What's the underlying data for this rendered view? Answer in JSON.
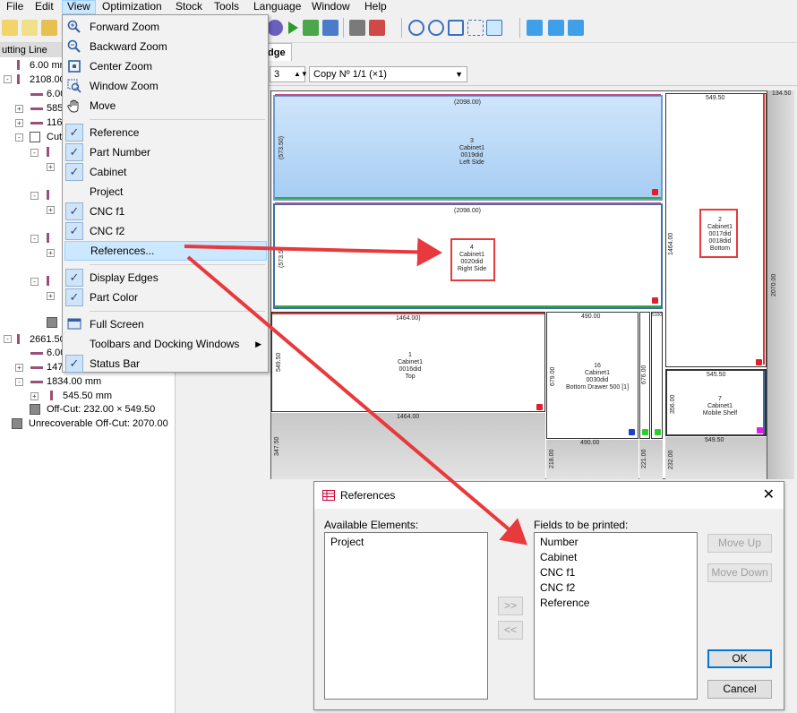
{
  "menubar": {
    "items": [
      "File",
      "Edit",
      "View",
      "Optimization",
      "Stock",
      "Tools",
      "Language",
      "Window",
      "Help"
    ]
  },
  "tree": {
    "header": "utting Line",
    "rows": [
      "6.00 mm",
      "2108.00",
      "6.00",
      "585",
      "116",
      "Cut",
      "2661.50",
      "6.00",
      "147",
      "1834.00 mm",
      "545.50 mm",
      "Off-Cut: 232.00 × 549.50",
      "Unrecoverable Off-Cut: 2070.00"
    ]
  },
  "view_menu": {
    "items": [
      {
        "label": "Forward Zoom",
        "icon": "zoom-in-icon"
      },
      {
        "label": "Backward Zoom",
        "icon": "zoom-out-icon"
      },
      {
        "label": "Center Zoom",
        "icon": "center-zoom-icon"
      },
      {
        "label": "Window Zoom",
        "icon": "window-zoom-icon"
      },
      {
        "label": "Move",
        "icon": "hand-icon"
      },
      {
        "label": "Reference",
        "checked": true
      },
      {
        "label": "Part Number",
        "checked": true
      },
      {
        "label": "Cabinet",
        "checked": true
      },
      {
        "label": "Project",
        "checked": false
      },
      {
        "label": "CNC f1",
        "checked": true
      },
      {
        "label": "CNC f2",
        "checked": true
      },
      {
        "label": "References...",
        "highlighted": true
      },
      {
        "label": "Display Edges",
        "checked": true
      },
      {
        "label": "Part Color",
        "checked": true
      },
      {
        "label": "Full Screen",
        "icon": "full-screen-icon"
      },
      {
        "label": "Toolbars and Docking Windows",
        "submenu": true
      },
      {
        "label": "Status Bar",
        "checked": true
      }
    ]
  },
  "tab_label": "dge",
  "options": {
    "number_value": "3",
    "copy_select": "Copy Nº 1/1 (×1)"
  },
  "sheet": {
    "top_left_dim": "(2098.00)",
    "top_right_dim": "549.50",
    "right_strip_dim": "134.50",
    "right_strip_vdim": "2070.00",
    "pieces": [
      {
        "id": "piece-3",
        "lines": [
          "3",
          "Cabinet1",
          "0019did",
          "Left Side"
        ],
        "vdim": "(573.50)",
        "hdim": "(2098.00)"
      },
      {
        "id": "piece-4",
        "lines": [
          "4",
          "Cabinet1",
          "0020did",
          "Right Side"
        ],
        "vdim": "(573.5",
        "hdim": "(2098.00)"
      },
      {
        "id": "piece-2",
        "lines": [
          "2",
          "Cabinet1",
          "0017did",
          "0018did",
          "Bottom"
        ],
        "vdim": "1464.00"
      },
      {
        "id": "piece-1",
        "lines": [
          "1",
          "Cabinet1",
          "0016did",
          "Top"
        ],
        "vdim": "549.50",
        "hdim": "1464.00)"
      },
      {
        "id": "piece-16",
        "lines": [
          "16",
          "Cabinet1",
          "0030did",
          "Bottom Drawer 500 [1]"
        ],
        "vdim": "679.00",
        "hdim": "490.00"
      },
      {
        "id": "piece-7",
        "lines": [
          "7",
          "Cabinet1",
          "Mobile Shelf"
        ],
        "vdim": "356.00",
        "hdim": "545.50"
      }
    ],
    "dims": {
      "strip_676": "676.00",
      "strip_top": "5100",
      "gray_bottom_left_h": "1464.00",
      "gray_bottom_left_v": "347.50",
      "gray_mid_h": "490.00",
      "gray_mid_v": "218.00",
      "gray_narrow_v": "221.00",
      "gray_right_h": "549.50",
      "gray_right_v": "232.00"
    }
  },
  "dialog": {
    "title": "References",
    "available_label": "Available Elements:",
    "available_items": [
      "Project"
    ],
    "printed_label": "Fields to be printed:",
    "printed_items": [
      "Number",
      "Cabinet",
      "CNC f1",
      "CNC f2",
      "Reference"
    ],
    "add_button": ">>",
    "remove_button": "<<",
    "move_up": "Move Up",
    "move_down": "Move Down",
    "ok": "OK",
    "cancel": "Cancel"
  },
  "colors": {
    "highlight_red": "#e8393c",
    "menu_highlight": "#cce8ff",
    "selected_piece": "#b6d8f7",
    "tree_bar": "#9b4f7a"
  }
}
